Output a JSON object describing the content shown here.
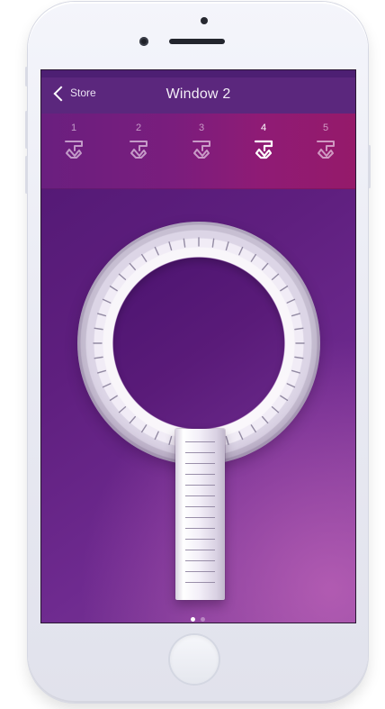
{
  "header": {
    "back_label": "Store",
    "title": "Window 2"
  },
  "tabs": [
    {
      "number": "1",
      "icon": "hand-shade-icon",
      "active": false
    },
    {
      "number": "2",
      "icon": "hand-shade-icon",
      "active": false
    },
    {
      "number": "3",
      "icon": "hand-shade-icon",
      "active": false
    },
    {
      "number": "4",
      "icon": "hand-shade-icon",
      "active": true
    },
    {
      "number": "5",
      "icon": "hand-shade-icon",
      "active": false
    }
  ],
  "pager": {
    "active_page": 1,
    "page_count": 2
  },
  "buttons": {
    "left_icon": "lightbulb-icon",
    "right_icon": "binoculars-icon"
  },
  "colors": {
    "accent": "#8f1b75",
    "background_dark": "#4f1771",
    "background_light": "#c668bc"
  }
}
